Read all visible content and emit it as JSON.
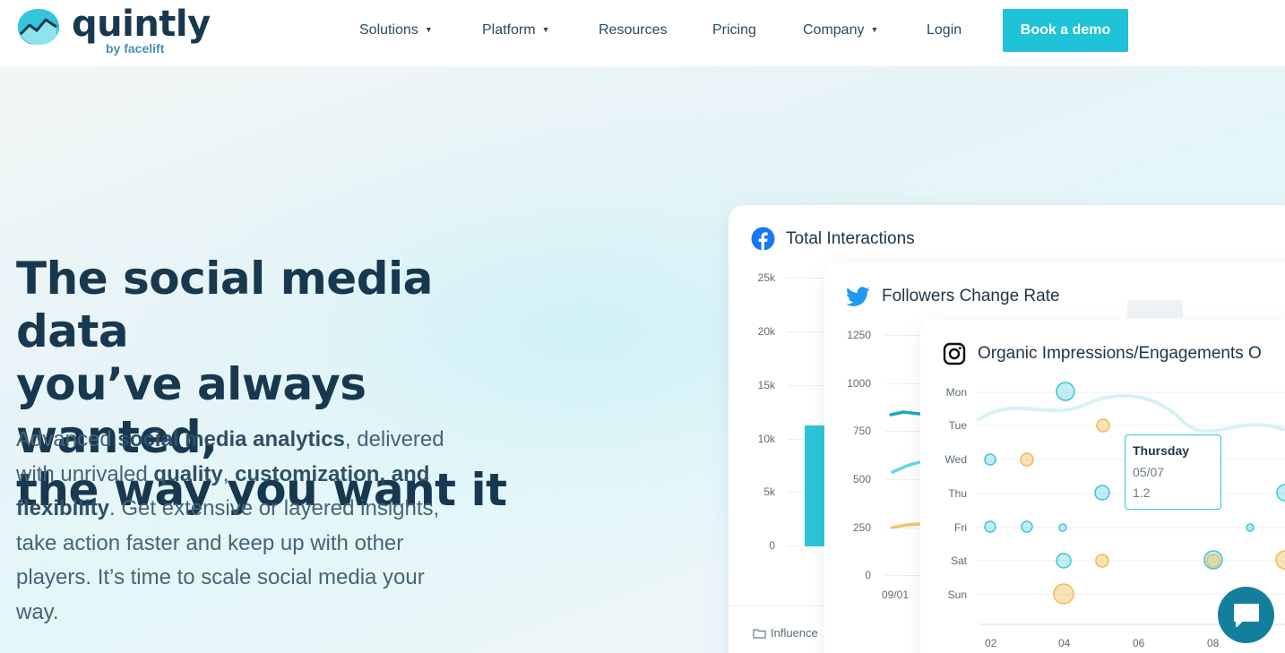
{
  "brand": {
    "name": "quintly",
    "sub": "by facelift"
  },
  "nav": {
    "solutions": "Solutions",
    "platform": "Platform",
    "resources": "Resources",
    "pricing": "Pricing",
    "company": "Company",
    "login": "Login",
    "cta": "Book a demo"
  },
  "hero": {
    "title_l1": "The social media data",
    "title_l2": "you’ve always wanted,",
    "title_l3": "the way you want it",
    "b1": "Advanced ",
    "b2": "social media analytics",
    "b3": ", delivered",
    "b4": "with unrivaled ",
    "b5": "quality",
    "b6": ", ",
    "b7": "customization, and",
    "b8": "flexibility",
    "b9": ". Get extensive or layered insights,",
    "b10": "take action faster and keep up with other",
    "b11": "players. It’s time to scale social media your",
    "b12": "way."
  },
  "colors": {
    "accent": "#1ec3d7",
    "navy": "#17384e",
    "orange": "#f2c46a",
    "chat": "#137f9d"
  },
  "cards": {
    "facebook": {
      "icon": "facebook-icon",
      "title": "Total Interactions",
      "yticks": [
        "25k",
        "20k",
        "15k",
        "10k",
        "5k",
        "0"
      ],
      "folder_label": "Influence"
    },
    "twitter": {
      "icon": "twitter-icon",
      "title": "Followers Change Rate",
      "yticks": [
        "1250",
        "1000",
        "750",
        "500",
        "250",
        "0"
      ],
      "xtick": "09/01"
    },
    "instagram": {
      "icon": "instagram-icon",
      "title": "Organic Impressions/Engagements O",
      "days": [
        "Mon",
        "Tue",
        "Wed",
        "Thu",
        "Fri",
        "Sat",
        "Sun"
      ],
      "xticks": [
        "02",
        "04",
        "06",
        "08"
      ],
      "tooltip": {
        "title": "Thursday",
        "date": "05/07",
        "value": "1.2"
      }
    }
  },
  "chat": {
    "icon": "chat-icon"
  }
}
